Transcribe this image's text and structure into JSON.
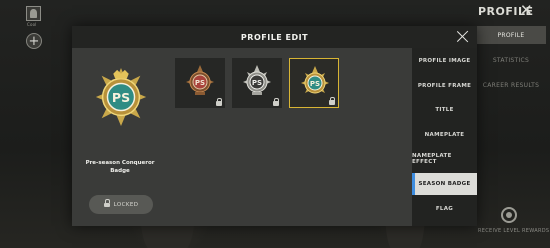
{
  "background": {
    "player_caption": "Cool",
    "add_symbol": "+",
    "title": "PROFILE",
    "close_symbol": "✕",
    "tabs": [
      {
        "label": "PROFILE",
        "active": true
      },
      {
        "label": "STATISTICS",
        "active": false
      },
      {
        "label": "CAREER RESULTS",
        "active": false
      }
    ],
    "rewards_label": "RECEIVE LEVEL REWARDS"
  },
  "dialog": {
    "title": "PROFILE EDIT",
    "preview": {
      "badge_text": "PS",
      "name": "Pre-season Conqueror Badge",
      "status_label": "LOCKED"
    },
    "badges": [
      {
        "icon": "pre-season-badge-bronze",
        "locked": true,
        "selected": false
      },
      {
        "icon": "pre-season-badge-silver",
        "locked": true,
        "selected": false
      },
      {
        "icon": "pre-season-badge-conqueror",
        "locked": true,
        "selected": true
      }
    ],
    "menu": [
      {
        "label": "PROFILE IMAGE",
        "active": false
      },
      {
        "label": "PROFILE FRAME",
        "active": false
      },
      {
        "label": "TITLE",
        "active": false
      },
      {
        "label": "NAMEPLATE",
        "active": false
      },
      {
        "label": "NAMEPLATE EFFECT",
        "active": false
      },
      {
        "label": "SEASON BADGE",
        "active": true
      },
      {
        "label": "FLAG",
        "active": false
      }
    ]
  },
  "colors": {
    "accent_gold": "#d8b534",
    "accent_blue": "#3d8de0",
    "badge_teal": "#2f8c84"
  }
}
